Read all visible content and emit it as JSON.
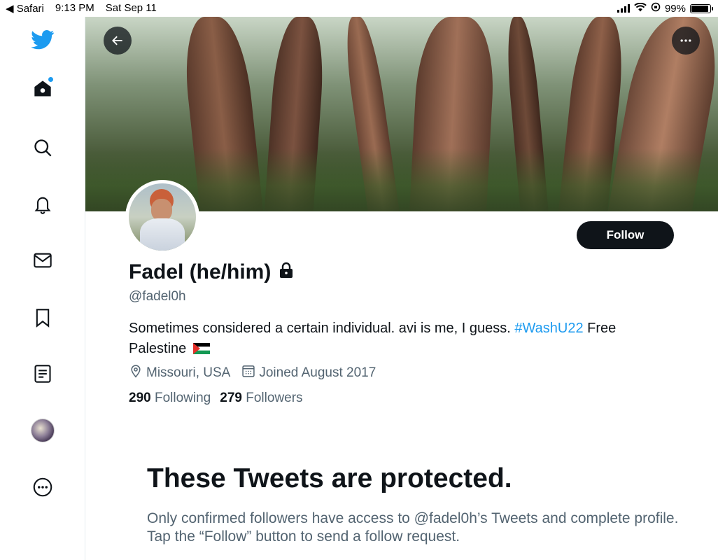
{
  "status_bar": {
    "back_app": "◀ Safari",
    "time": "9:13 PM",
    "date": "Sat Sep 11",
    "battery": "99%",
    "battery_level": 0.99
  },
  "sidebar": {
    "items": [
      {
        "name": "twitter-logo-icon"
      },
      {
        "name": "home-icon"
      },
      {
        "name": "search-icon"
      },
      {
        "name": "notifications-bell-icon"
      },
      {
        "name": "messages-mail-icon"
      },
      {
        "name": "bookmarks-icon"
      },
      {
        "name": "lists-icon"
      },
      {
        "name": "profile-avatar"
      },
      {
        "name": "more-icon"
      }
    ]
  },
  "profile": {
    "name": "Fadel (he/him)",
    "handle": "@fadel0h",
    "bio_text": "Sometimes considered a certain individual. avi is me, I guess.",
    "bio_hashtag": "#WashU22",
    "bio_tail": "Free",
    "bio_line2": "Palestine",
    "location": "Missouri, USA",
    "joined": "Joined August 2017",
    "following_count": "290",
    "following_label": "Following",
    "followers_count": "279",
    "followers_label": "Followers",
    "follow_button": "Follow"
  },
  "protected": {
    "title": "These Tweets are protected.",
    "body": "Only confirmed followers have access to @fadel0h’s Tweets and complete profile. Tap the “Follow” button to send a follow request."
  },
  "colors": {
    "accent": "#1d9bf0",
    "text": "#0f1419",
    "secondary": "#536471"
  }
}
